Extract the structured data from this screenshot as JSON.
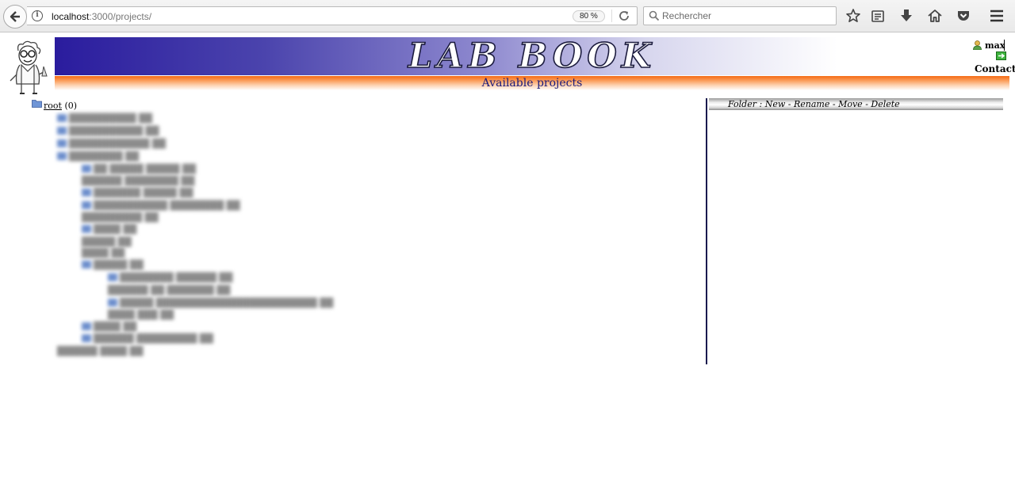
{
  "browser": {
    "url_host": "localhost",
    "url_rest": ":3000/projects/",
    "zoom": "80 %",
    "search_placeholder": "Rechercher"
  },
  "header": {
    "banner_title": "LAB BOOK",
    "subtitle": "Available projects"
  },
  "user": {
    "name": "max",
    "contact": "Contact"
  },
  "tree": {
    "root_label": "root",
    "root_count": "(0)"
  },
  "folder_menu": {
    "label": "Folder :",
    "items": [
      "New",
      "Rename",
      "Move",
      "Delete"
    ],
    "separator": "-"
  }
}
